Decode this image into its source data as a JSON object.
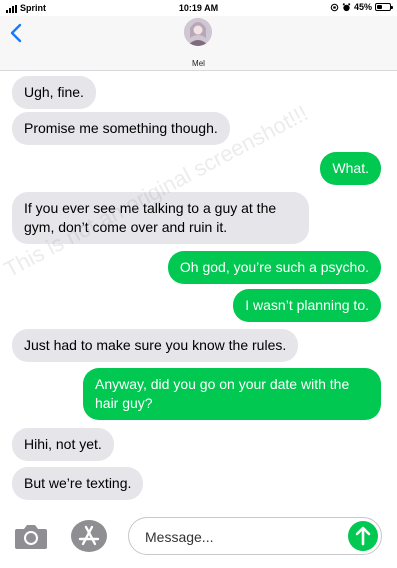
{
  "status_bar": {
    "carrier": "Sprint",
    "time": "10:19 AM",
    "battery_percent": "45%",
    "battery_level": 0.45
  },
  "header": {
    "contact_name": "Mel"
  },
  "watermark": "This is not an original screenshot!!!",
  "messages": [
    {
      "direction": "in",
      "text": "Ugh, fine."
    },
    {
      "direction": "in",
      "text": "Promise me something though."
    },
    {
      "direction": "out",
      "text": "What."
    },
    {
      "direction": "in",
      "text": "If you ever see me talking to a guy at the gym, don’t come over and ruin it."
    },
    {
      "direction": "out",
      "text": "Oh god, you’re such a psycho."
    },
    {
      "direction": "out",
      "text": "I wasn’t planning to."
    },
    {
      "direction": "in",
      "text": "Just had to make sure you know the rules."
    },
    {
      "direction": "out",
      "text": "Anyway, did you go on your date with the hair guy?"
    },
    {
      "direction": "in",
      "text": "Hihi, not yet."
    },
    {
      "direction": "in",
      "text": "But we’re texting."
    }
  ],
  "composer": {
    "placeholder": "Message..."
  },
  "colors": {
    "outgoing_bubble": "#00c851",
    "incoming_bubble": "#e5e5ea",
    "accent_blue": "#1a7cf5"
  },
  "icons": {
    "back": "chevron-left-icon",
    "camera": "camera-icon",
    "appstore": "appstore-icon",
    "send": "send-arrow-icon"
  }
}
